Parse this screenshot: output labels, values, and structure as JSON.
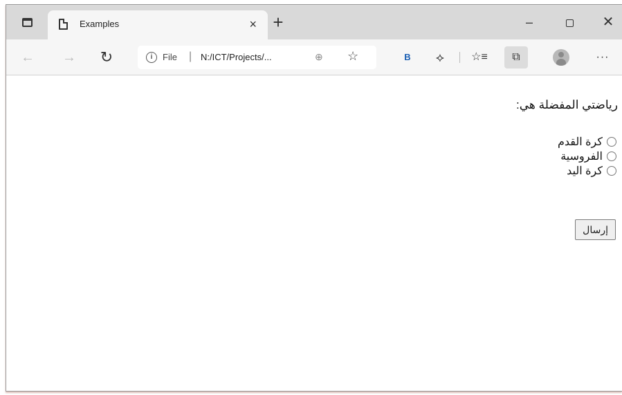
{
  "browser": {
    "tab": {
      "title": "Examples",
      "close": "×"
    },
    "new_tab": "+",
    "window_controls": {
      "minimize": "–",
      "close": "✕"
    },
    "nav": {
      "back": "←",
      "forward": "→",
      "reload": "↻"
    },
    "address": {
      "scheme": "File",
      "separator": "|",
      "url": "N:/ICT/Projects/...",
      "info_icon": "i"
    },
    "toolbar_icons": {
      "extension_b": "B",
      "extensions": "puzzle-icon",
      "favorites": "favorites-icon",
      "collections": "collections-icon",
      "more": "···"
    }
  },
  "page": {
    "question": "رياضتي المفضلة هي:",
    "options": [
      {
        "label": "كرة القدم"
      },
      {
        "label": "الفروسية"
      },
      {
        "label": "كرة اليد"
      }
    ],
    "submit_label": "إرسال"
  }
}
